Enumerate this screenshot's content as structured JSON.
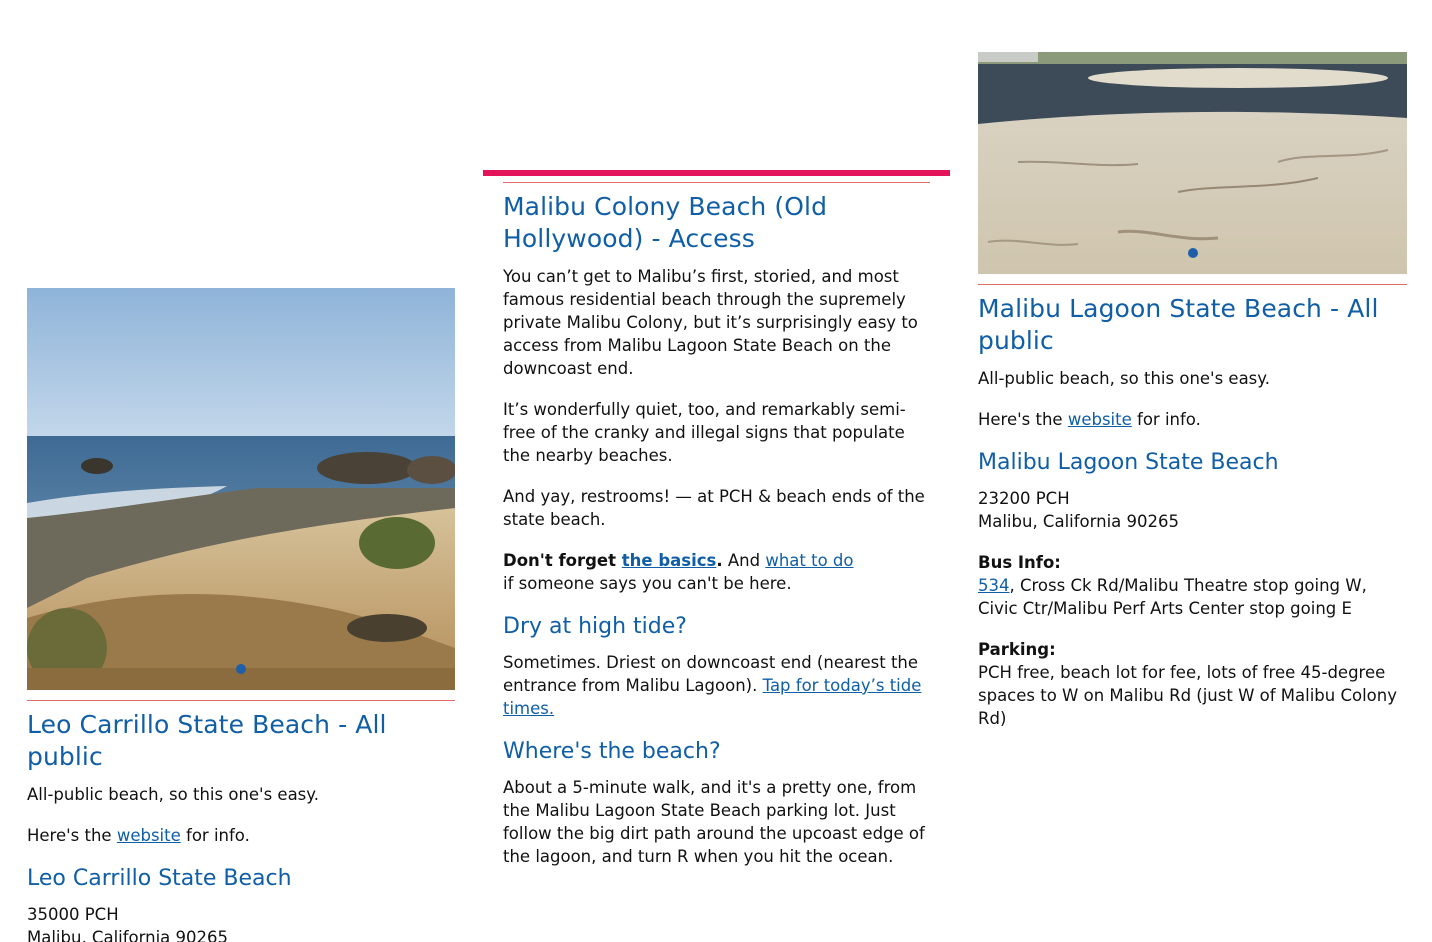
{
  "left": {
    "title": "Leo Carrillo State Beach - All public",
    "easy_text": "All-public beach, so this one's easy.",
    "website_prefix": "Here's the ",
    "website_link": "website",
    "website_suffix": " for info.",
    "place_name": "Leo Carrillo State Beach",
    "address_line1": "35000 PCH",
    "address_line2": "Malibu, California 90265"
  },
  "middle": {
    "title": "Malibu Colony Beach (Old Hollywood) - Access",
    "p1": "You can’t get to Malibu’s first, storied, and most famous residential beach through the supremely private Malibu Colony, but it’s surprisingly easy to access from Malibu Lagoon State Beach on the downcoast end.",
    "p2": "It’s wonderfully quiet, too, and remarkably semi-free of the cranky and illegal signs that populate the nearby beaches.",
    "p3": "And yay, restrooms! — at PCH & beach ends of the state beach.",
    "dont_forget": "Don't forget ",
    "basics_link": "the basics",
    "period": ".",
    "and_text": " And ",
    "what_to_do_link": "what to do",
    "if_text": "if someone says you can't be here.",
    "dry_heading": "Dry at high tide?",
    "dry_text": "Sometimes. Driest on downcoast end (nearest the entrance from Malibu Lagoon). ",
    "tide_link": "Tap for today’s tide times.",
    "where_heading": "Where's the beach?",
    "where_text": "About a 5-minute walk, and it's a pretty one, from the Malibu Lagoon State Beach parking lot. Just follow the big dirt path around the upcoast edge of the lagoon, and turn R when you hit the ocean."
  },
  "right": {
    "title": "Malibu Lagoon State Beach - All public",
    "easy_text": "All-public beach, so this one's easy.",
    "website_prefix": "Here's the ",
    "website_link": "website",
    "website_suffix": " for info.",
    "place_name": "Malibu Lagoon State Beach",
    "address_line1": "23200 PCH",
    "address_line2": "Malibu, California 90265",
    "bus_label": "Bus Info:",
    "bus_route_link": "534",
    "bus_text": ", Cross Ck Rd/Malibu Theatre stop going W, Civic Ctr/Malibu Perf Arts Center stop going E",
    "parking_label": "Parking:",
    "parking_text": "PCH free, beach lot for fee, lots of free 45-degree spaces to W on Malibu Rd (just W of Malibu Colony Rd)"
  },
  "colors": {
    "link_blue": "#0f5ea6",
    "accent_pink": "#e4145a",
    "rule_red": "#d9534f"
  }
}
